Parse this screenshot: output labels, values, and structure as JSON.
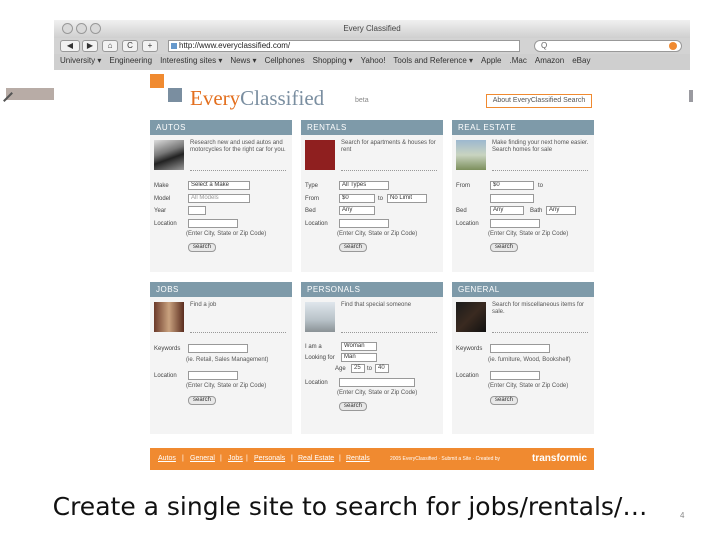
{
  "window": {
    "title": "Every Classified"
  },
  "toolbar": {
    "back": "◀",
    "forward": "▶",
    "home": "⌂",
    "reload": "C",
    "add": "+",
    "url": "http://www.everyclassified.com/",
    "search_placeholder": "Q"
  },
  "bookmarks": [
    "University ▾",
    "Engineering",
    "Interesting sites ▾",
    "News ▾",
    "Cellphones",
    "Shopping ▾",
    "Yahoo!",
    "Tools and Reference ▾",
    "Apple",
    ".Mac",
    "Amazon",
    "eBay"
  ],
  "site": {
    "logo_every": "Every",
    "logo_classified": "Classified",
    "beta": "beta",
    "about": "About EveryClassified Search"
  },
  "autos": {
    "title": "AUTOS",
    "desc": "Research new and used autos and motorcycles for the right car for you.",
    "make_label": "Make",
    "make_value": "Select a Make",
    "model_label": "Model",
    "model_value": "All Models",
    "year_label": "Year",
    "location_label": "Location",
    "hint": "(Enter City, State or Zip Code)",
    "search": "search"
  },
  "rentals": {
    "title": "RENTALS",
    "desc": "Search for apartments & houses for rent",
    "type_label": "Type",
    "type_value": "All Types",
    "from_label": "From",
    "from_value": "$0",
    "to": "to",
    "to_value": "No Limit",
    "bed_label": "Bed",
    "bed_value": "Any",
    "location_label": "Location",
    "hint": "(Enter City, State or Zip Code)",
    "search": "search"
  },
  "realestate": {
    "title": "REAL ESTATE",
    "desc": "Make finding your next home easier. Search homes for sale",
    "from_label": "From",
    "from_value": "$0",
    "to": "to",
    "bed_label": "Bed",
    "bed_value": "Any",
    "bath_label": "Bath",
    "bath_value": "Any",
    "location_label": "Location",
    "hint": "(Enter City, State or Zip Code)",
    "search": "search"
  },
  "jobs": {
    "title": "JOBS",
    "desc": "Find a job",
    "keywords_label": "Keywords",
    "keywords_hint": "(ie. Retail, Sales Management)",
    "location_label": "Location",
    "hint": "(Enter City, State or Zip Code)",
    "search": "search"
  },
  "personals": {
    "title": "PERSONALS",
    "desc": "Find that special someone",
    "iama_label": "I am a",
    "iama_value": "Woman",
    "lookingfor_label": "Looking for",
    "lookingfor_value": "Man",
    "age_label": "Age",
    "age_from": "25",
    "to": "to",
    "age_to": "40",
    "location_label": "Location",
    "hint": "(Enter City, State or Zip Code)",
    "search": "search"
  },
  "general": {
    "title": "GENERAL",
    "desc": "Search for miscellaneous items for sale.",
    "keywords_label": "Keywords",
    "keywords_hint": "(ie. furniture, Wood, Bookshelf)",
    "location_label": "Location",
    "hint": "(Enter City, State or Zip Code)",
    "search": "search"
  },
  "footer": {
    "links": [
      "Autos",
      "General",
      "Jobs",
      "Personals",
      "Real Estate",
      "Rentals"
    ],
    "sep": "|",
    "copyright": "2005 EveryClassified · Submit a Site · Created by",
    "brand": "transformic"
  },
  "caption": "Create a single site to search for jobs/rentals/…",
  "slide_number": "4",
  "colors": {
    "accent": "#f08a30",
    "panel_header": "#7e9aa9",
    "logo_every": "#e36f1e",
    "logo_classified": "#7a8ea0"
  }
}
